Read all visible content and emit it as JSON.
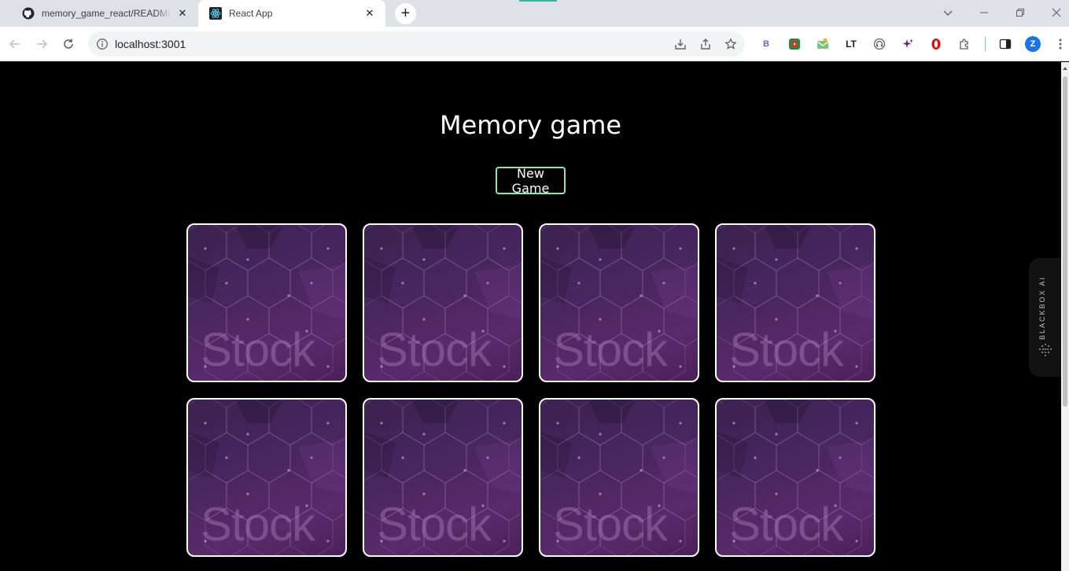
{
  "browser": {
    "tabs": [
      {
        "title": "memory_game_react/README.md",
        "favicon": "github-icon",
        "active": false
      },
      {
        "title": "React App",
        "favicon": "react-icon",
        "active": true
      }
    ],
    "address": "localhost:3001",
    "extensions": [
      "B",
      "youtube-icon",
      "mail-icon",
      "LT",
      "headphones-icon",
      "sparkle-icon",
      "shield-icon",
      "puzzle-icon",
      "sidepanel-icon"
    ],
    "profile_initial": "Z"
  },
  "game": {
    "title": "Memory game",
    "new_game_label": "New Game",
    "cards": [
      {
        "face": "down",
        "watermark": "Stock"
      },
      {
        "face": "down",
        "watermark": "Stock"
      },
      {
        "face": "down",
        "watermark": "Stock"
      },
      {
        "face": "down",
        "watermark": "Stock"
      },
      {
        "face": "down",
        "watermark": "Stock"
      },
      {
        "face": "down",
        "watermark": "Stock"
      },
      {
        "face": "down",
        "watermark": "Stock"
      },
      {
        "face": "down",
        "watermark": "Stock"
      }
    ]
  },
  "sidebar_widget": {
    "label": "BLACKBOX AI"
  },
  "colors": {
    "page_bg": "#000000",
    "button_border": "#8ee6b0",
    "card_purple": "#4a2660"
  }
}
